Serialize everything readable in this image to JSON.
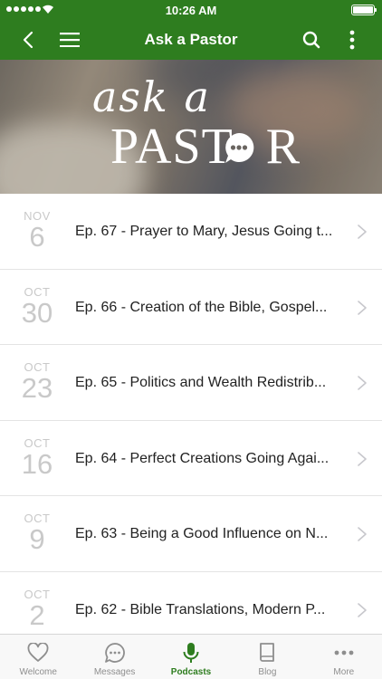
{
  "status_bar": {
    "time": "10:26 AM"
  },
  "nav": {
    "title": "Ask a Pastor",
    "icons": [
      "chevron-left-icon",
      "hamburger-menu-icon",
      "search-icon",
      "vertical-ellipsis-icon"
    ]
  },
  "banner": {
    "script_text": "ask a",
    "main_text_pre": "PAST",
    "main_text_post": "R"
  },
  "episodes": [
    {
      "month": "NOV",
      "day": "6",
      "title": "Ep. 67 - Prayer to Mary, Jesus Going t..."
    },
    {
      "month": "OCT",
      "day": "30",
      "title": "Ep. 66 - Creation of the Bible, Gospel..."
    },
    {
      "month": "OCT",
      "day": "23",
      "title": "Ep. 65 - Politics and Wealth Redistrib..."
    },
    {
      "month": "OCT",
      "day": "16",
      "title": "Ep. 64 - Perfect Creations Going Agai..."
    },
    {
      "month": "OCT",
      "day": "9",
      "title": "Ep. 63 - Being a Good Influence on N..."
    },
    {
      "month": "OCT",
      "day": "2",
      "title": "Ep. 62 - Bible Translations, Modern P..."
    }
  ],
  "tabs": [
    {
      "label": "Welcome",
      "icon": "heart-icon"
    },
    {
      "label": "Messages",
      "icon": "chat-bubble-icon"
    },
    {
      "label": "Podcasts",
      "icon": "microphone-icon",
      "active": true
    },
    {
      "label": "Blog",
      "icon": "book-icon"
    },
    {
      "label": "More",
      "icon": "ellipsis-icon"
    }
  ],
  "colors": {
    "brand_green": "#2e7d1f",
    "date_gray": "#c9c9c9",
    "tab_inactive": "#8e8e8e"
  }
}
